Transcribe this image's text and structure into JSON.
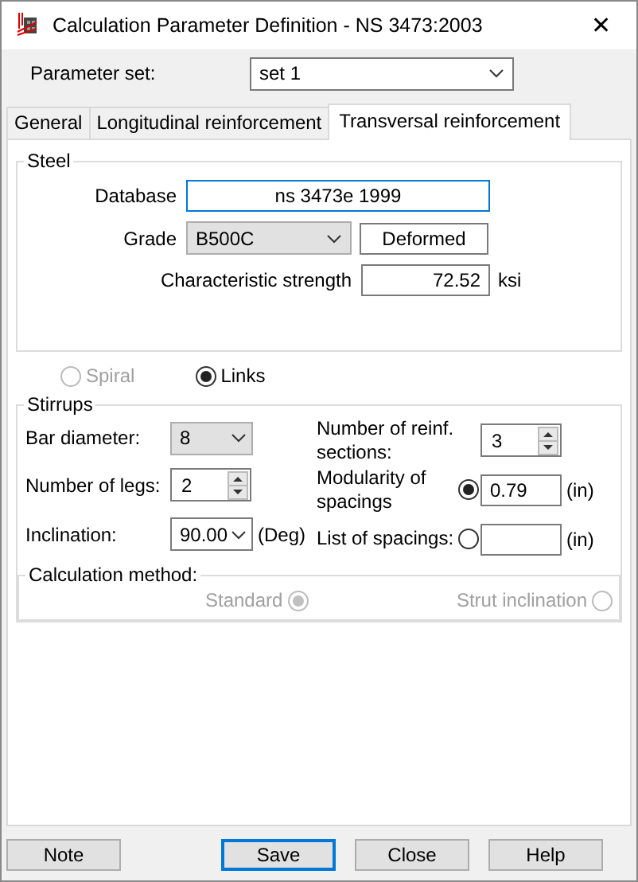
{
  "window": {
    "title": "Calculation Parameter Definition - NS 3473:2003",
    "close": "✕"
  },
  "parameter_set": {
    "label": "Parameter set:",
    "value": "set 1"
  },
  "tabs": [
    {
      "label": "General",
      "selected": false
    },
    {
      "label": "Longitudinal reinforcement",
      "selected": false
    },
    {
      "label": "Transversal reinforcement",
      "selected": true
    }
  ],
  "steel": {
    "title": "Steel",
    "database": {
      "label": "Database",
      "value": "ns 3473e 1999"
    },
    "grade": {
      "label": "Grade",
      "value": "B500C"
    },
    "bar_type": "Deformed",
    "strength": {
      "label": "Characteristic strength",
      "value": "72.52",
      "unit": "ksi"
    }
  },
  "shape_options": [
    {
      "label": "Spiral",
      "selected": false,
      "disabled": true
    },
    {
      "label": "Links",
      "selected": true,
      "disabled": false
    }
  ],
  "stirrups": {
    "title": "Stirrups",
    "bar_diameter": {
      "label": "Bar diameter:",
      "value": "8"
    },
    "legs": {
      "label": "Number of legs:",
      "value": "2"
    },
    "inclination": {
      "label": "Inclination:",
      "value": "90.00",
      "unit": "(Deg)"
    },
    "sections": {
      "label": "Number of reinf. sections:",
      "value": "3"
    },
    "spacing_options": [
      {
        "label": "Modularity of spacings",
        "selected": true,
        "value": "0.79",
        "unit": "(in)"
      },
      {
        "label": "List of spacings:",
        "selected": false,
        "unit": "(in)"
      }
    ]
  },
  "calculation_method": {
    "title": "Calculation method:",
    "options": [
      {
        "label": "Standard",
        "selected": true,
        "disabled": true
      },
      {
        "label": "Strut inclination",
        "selected": false,
        "disabled": true
      }
    ]
  },
  "buttons": [
    {
      "label": "Note",
      "default": false
    },
    {
      "label": "Save",
      "default": true
    },
    {
      "label": "Close",
      "default": false
    },
    {
      "label": "Help",
      "default": false
    }
  ]
}
